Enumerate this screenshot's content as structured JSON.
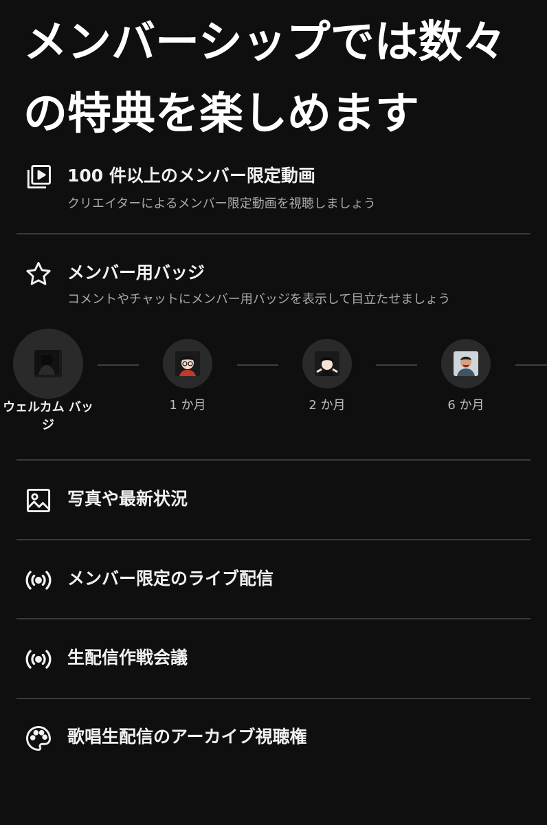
{
  "headline": "メンバーシップでは数々の特典を楽しめます",
  "perks": [
    {
      "title": "100 件以上のメンバー限定動画",
      "subtitle": "クリエイターによるメンバー限定動画を視聴しましょう",
      "icon": "video-library-icon"
    },
    {
      "title": "メンバー用バッジ",
      "subtitle": "コメントやチャットにメンバー用バッジを表示して目立たせましょう",
      "icon": "star-icon"
    },
    {
      "title": "写真や最新状況",
      "icon": "image-icon"
    },
    {
      "title": "メンバー限定のライブ配信",
      "icon": "live-broadcast-icon"
    },
    {
      "title": "生配信作戦会議",
      "icon": "live-broadcast-icon"
    },
    {
      "title": "歌唱生配信のアーカイブ視聴権",
      "icon": "palette-icon"
    }
  ],
  "badges": [
    {
      "label": "ウェルカム バッジ",
      "icon": "welcome-badge-avatar"
    },
    {
      "label": "1 か月",
      "icon": "one-month-badge-avatar"
    },
    {
      "label": "2 か月",
      "icon": "two-month-badge-avatar"
    },
    {
      "label": "6 か月",
      "icon": "six-month-badge-avatar"
    }
  ],
  "colors": {
    "background": "#0f0f0f",
    "text": "#f1f1f1",
    "secondary_text": "#aaaaaa",
    "divider": "#3a3a3a"
  }
}
